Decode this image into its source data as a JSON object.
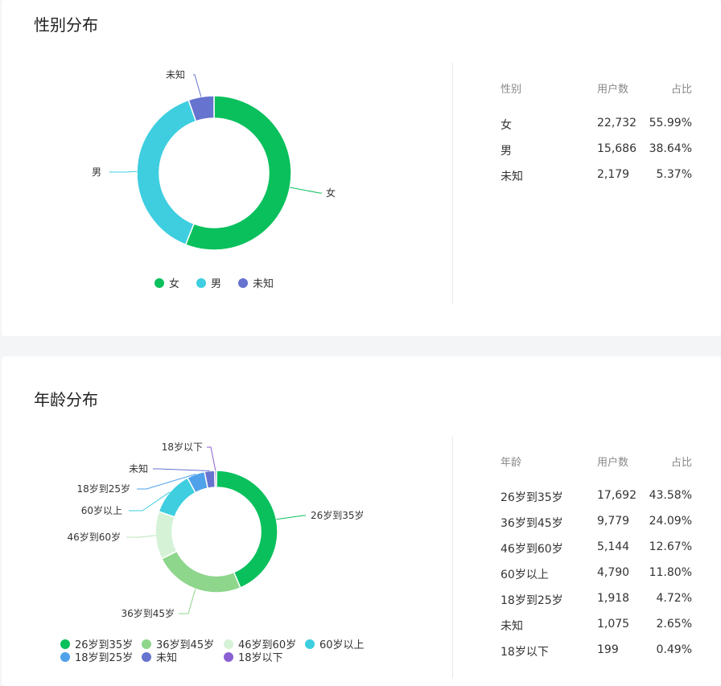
{
  "gender": {
    "title": "性别分布",
    "table_headers": [
      "性别",
      "用户数",
      "占比"
    ],
    "rows": [
      {
        "label": "女",
        "count": "22,732",
        "pct": "55.99%"
      },
      {
        "label": "男",
        "count": "15,686",
        "pct": "38.64%"
      },
      {
        "label": "未知",
        "count": "2,179",
        "pct": "5.37%"
      }
    ]
  },
  "age": {
    "title": "年龄分布",
    "table_headers": [
      "年龄",
      "用户数",
      "占比"
    ],
    "rows": [
      {
        "label": "26岁到35岁",
        "count": "17,692",
        "pct": "43.58%"
      },
      {
        "label": "36岁到45岁",
        "count": "9,779",
        "pct": "24.09%"
      },
      {
        "label": "46岁到60岁",
        "count": "5,144",
        "pct": "12.67%"
      },
      {
        "label": "60岁以上",
        "count": "4,790",
        "pct": "11.80%"
      },
      {
        "label": "18岁到25岁",
        "count": "1,918",
        "pct": "4.72%"
      },
      {
        "label": "未知",
        "count": "1,075",
        "pct": "2.65%"
      },
      {
        "label": "18岁以下",
        "count": "199",
        "pct": "0.49%"
      }
    ]
  },
  "chart_data": [
    {
      "type": "pie",
      "title": "性别分布",
      "categories": [
        "女",
        "男",
        "未知"
      ],
      "values": [
        22732,
        15686,
        2179
      ],
      "colors": [
        "#09c05c",
        "#3ecee0",
        "#6673cf"
      ],
      "legend": "bottom"
    },
    {
      "type": "pie",
      "title": "年龄分布",
      "categories": [
        "26岁到35岁",
        "36岁到45岁",
        "46岁到60岁",
        "60岁以上",
        "18岁到25岁",
        "未知",
        "18岁以下"
      ],
      "values": [
        17692,
        9779,
        5144,
        4790,
        1918,
        1075,
        199
      ],
      "colors": [
        "#09c05c",
        "#8dd68c",
        "#d5f2d6",
        "#3ecee0",
        "#4fa1ea",
        "#6673cf",
        "#8a5fd1"
      ],
      "legend": "bottom"
    }
  ]
}
